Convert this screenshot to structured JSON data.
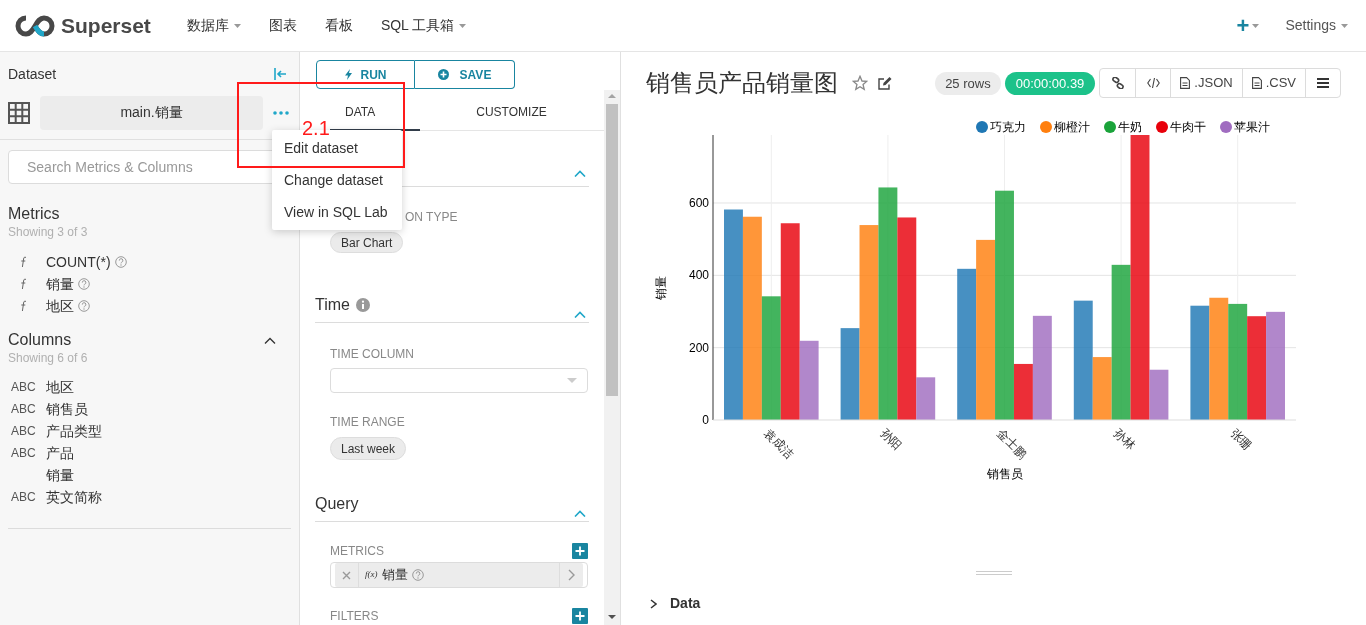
{
  "navbar": {
    "brand": "Superset",
    "menu": [
      {
        "label": "数据库",
        "dropdown": true
      },
      {
        "label": "图表",
        "dropdown": false
      },
      {
        "label": "看板",
        "dropdown": false
      },
      {
        "label": "SQL 工具箱",
        "dropdown": true
      }
    ],
    "new_button": "+",
    "settings": "Settings"
  },
  "dataset_panel": {
    "title": "Dataset",
    "dataset_name": "main.销量",
    "search_placeholder": "Search Metrics & Columns",
    "metrics": {
      "title": "Metrics",
      "count": "Showing 3 of 3",
      "items": [
        {
          "name": "COUNT(*)"
        },
        {
          "name": "销量"
        },
        {
          "name": "地区"
        }
      ]
    },
    "columns": {
      "title": "Columns",
      "count": "Showing 6 of 6",
      "expanded": true,
      "items": [
        {
          "type_label": "ABC",
          "name": "地区"
        },
        {
          "type_label": "ABC",
          "name": "销售员"
        },
        {
          "type_label": "ABC",
          "name": "产品类型"
        },
        {
          "type_label": "ABC",
          "name": "产品"
        },
        {
          "name": "销量"
        },
        {
          "type_label": "ABC",
          "name": "英文简称"
        }
      ]
    }
  },
  "dataset_menu": {
    "items": [
      "Edit dataset",
      "Change dataset",
      "View in SQL Lab"
    ]
  },
  "annotation": {
    "label": "2.1"
  },
  "control_panel": {
    "run": "RUN",
    "save": "SAVE",
    "tabs": [
      {
        "label": "DATA",
        "selected": true
      },
      {
        "label": "CUSTOMIZE",
        "selected": false
      }
    ],
    "viz_type": {
      "label": "ON TYPE",
      "value": "Bar Chart"
    },
    "time": {
      "title": "Time",
      "time_column_label": "TIME COLUMN",
      "time_range_label": "TIME RANGE",
      "time_range": "Last week"
    },
    "query": {
      "title": "Query",
      "metrics_label": "METRICS",
      "metric": {
        "prefix": "f(x)",
        "name": "销量"
      },
      "filters_label": "FILTERS"
    }
  },
  "chart_panel": {
    "title": "销售员产品销量图",
    "row_count": "25 rows",
    "duration": "00:00:00.39",
    "actions": [
      {
        "kind": "link"
      },
      {
        "kind": "code"
      },
      {
        "kind": "file",
        "label": ".JSON"
      },
      {
        "kind": "file",
        "label": ".CSV"
      },
      {
        "kind": "menu"
      }
    ],
    "chart_data": {
      "type": "bar",
      "xlabel": "销售员",
      "ylabel": "销量",
      "categories": [
        "袁成洁",
        "孙阳",
        "金士鹏",
        "孙林",
        "张珊"
      ],
      "series": [
        {
          "name": "巧克力",
          "color": "#1f77b4",
          "values": [
            582,
            254,
            418,
            330,
            316
          ]
        },
        {
          "name": "柳橙汁",
          "color": "#ff7f0e",
          "values": [
            562,
            539,
            498,
            174,
            338
          ]
        },
        {
          "name": "牛奶",
          "color": "#1aa33a",
          "values": [
            342,
            643,
            634,
            429,
            321
          ]
        },
        {
          "name": "牛肉干",
          "color": "#e8000b",
          "values": [
            544,
            560,
            155,
            788,
            287
          ]
        },
        {
          "name": "苹果汁",
          "color": "#a06cc0",
          "values": [
            219,
            118,
            288,
            139,
            299
          ]
        }
      ],
      "ylim": [
        0,
        788
      ],
      "yticks": [
        0,
        200,
        400,
        600
      ],
      "grid": true
    },
    "data_section": {
      "title": "Data",
      "expanded": false
    }
  }
}
